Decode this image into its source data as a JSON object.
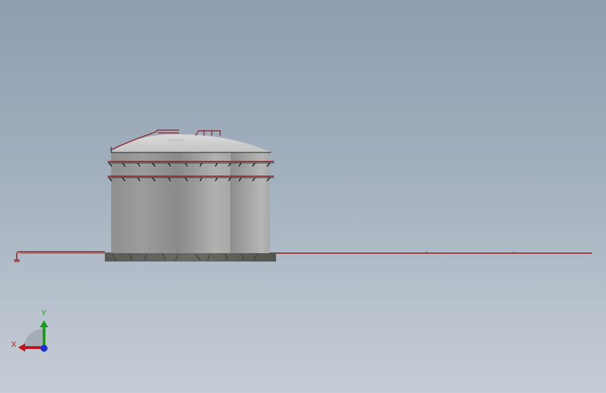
{
  "viewport": {
    "background_top": "#8e9eb0",
    "background_bottom": "#c6cdd6"
  },
  "model": {
    "shell_color": "#a3a3a3",
    "roof_color": "#d3d3d3",
    "pipe_color": "#8b1a1a",
    "base_color": "#5c5c58"
  },
  "triad": {
    "x_label": "X",
    "y_label": "Y",
    "x_color": "#c0101a",
    "y_color": "#1a9a1a",
    "z_color": "#1a2fd0"
  }
}
